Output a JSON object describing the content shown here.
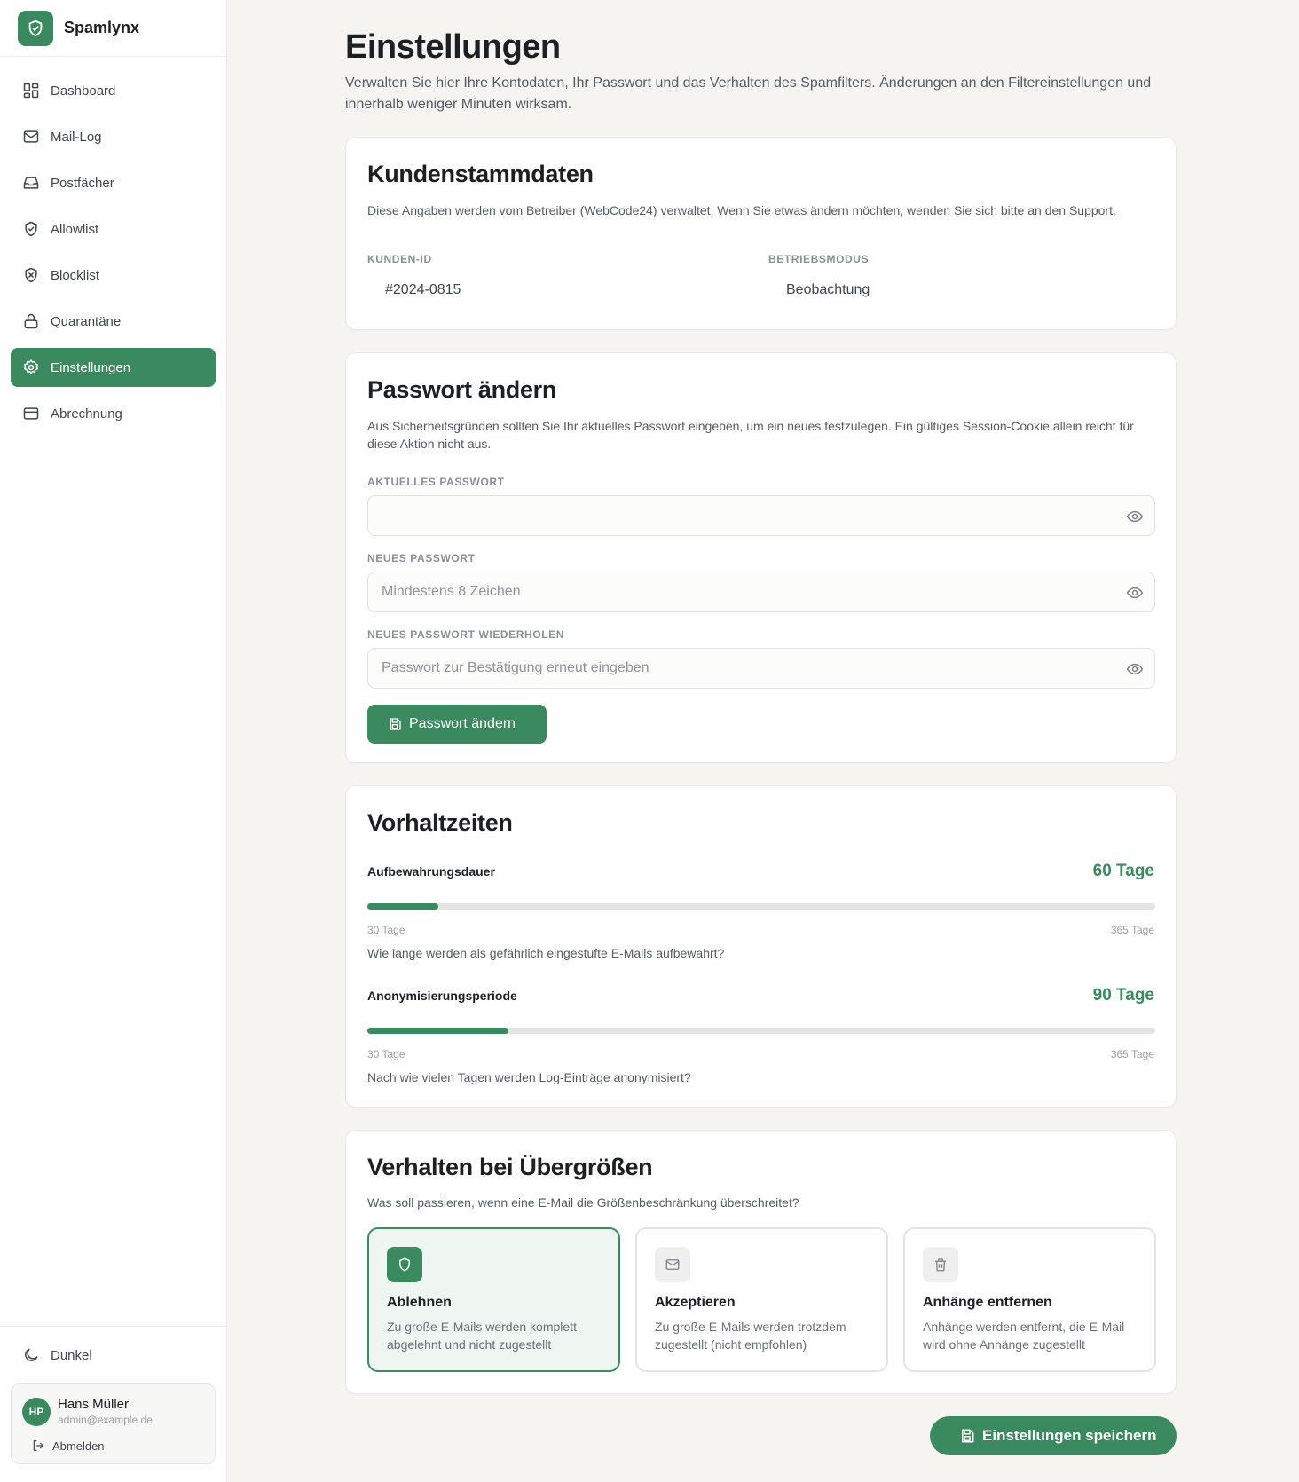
{
  "app": {
    "name": "Spamlynx"
  },
  "sidebar": {
    "items": [
      {
        "label": "Dashboard",
        "icon": "dashboard-icon"
      },
      {
        "label": "Mail-Log",
        "icon": "mail-icon"
      },
      {
        "label": "Postfächer",
        "icon": "inbox-icon"
      },
      {
        "label": "Allowlist",
        "icon": "shield-check-icon"
      },
      {
        "label": "Blocklist",
        "icon": "shield-x-icon"
      },
      {
        "label": "Quarantäne",
        "icon": "lock-icon"
      },
      {
        "label": "Einstellungen",
        "icon": "gear-icon",
        "active": true
      },
      {
        "label": "Abrechnung",
        "icon": "credit-card-icon"
      }
    ],
    "theme_label": "Dunkel",
    "user": {
      "initials": "HP",
      "name": "Hans Müller",
      "email": "admin@example.de",
      "logout_label": "Abmelden"
    }
  },
  "page": {
    "title": "Einstellungen",
    "description": "Verwalten Sie hier Ihre Kontodaten, Ihr Passwort und das Verhalten des Spamfilters. Änderungen an den Filtereinstellungen und innerhalb weniger Minuten wirksam."
  },
  "customer": {
    "title": "Kundenstammdaten",
    "text": "Diese Angaben werden vom Betreiber (WebCode24) verwaltet. Wenn Sie etwas ändern möchten, wenden Sie sich bitte an den Support.",
    "id_label": "Kunden-ID",
    "id_value": "#2024-0815",
    "mode_label": "Betriebsmodus",
    "mode_value": "Beobachtung"
  },
  "password": {
    "title": "Passwort ändern",
    "text": "Aus Sicherheitsgründen sollten Sie Ihr aktuelles Passwort eingeben, um ein neues festzulegen. Ein gültiges Session-Cookie allein reicht für diese Aktion nicht aus.",
    "current_label": "Aktuelles Passwort",
    "current_value": "",
    "current_placeholder": "",
    "new_label": "Neues Passwort",
    "new_value": "",
    "new_placeholder": "Mindestens 8 Zeichen",
    "repeat_label": "Neues Passwort wiederholen",
    "repeat_value": "",
    "repeat_placeholder": "Passwort zur Bestätigung erneut eingeben",
    "submit_label": "Passwort ändern"
  },
  "retention": {
    "title": "Vorhaltzeiten",
    "sliders": [
      {
        "label": "Aufbewahrungsdauer",
        "value": 60,
        "value_text": "60 Tage",
        "min": 30,
        "max": 365,
        "min_text": "30 Tage",
        "max_text": "365 Tage",
        "help": "Wie lange werden als gefährlich eingestufte E-Mails aufbewahrt?"
      },
      {
        "label": "Anonymisierungsperiode",
        "value": 90,
        "value_text": "90 Tage",
        "min": 30,
        "max": 365,
        "min_text": "30 Tage",
        "max_text": "365 Tage",
        "help": "Nach wie vielen Tagen werden Log-Einträge anonymisiert?"
      }
    ]
  },
  "oversize": {
    "title": "Verhalten bei Übergrößen",
    "text": "Was soll passieren, wenn eine E-Mail die Größenbeschränkung überschreitet?",
    "options": [
      {
        "title": "Ablehnen",
        "desc": "Zu große E-Mails werden komplett abgelehnt und nicht zugestellt",
        "icon": "shield-icon",
        "selected": true
      },
      {
        "title": "Akzeptieren",
        "desc": "Zu große E-Mails werden trotzdem zugestellt (nicht empfohlen)",
        "icon": "mail-icon",
        "selected": false
      },
      {
        "title": "Anhänge entfernen",
        "desc": "Anhänge werden entfernt, die E-Mail wird ohne Anhänge zugestellt",
        "icon": "trash-icon",
        "selected": false
      }
    ]
  },
  "save_label": "Einstellungen speichern",
  "colors": {
    "accent": "#3b8a5f",
    "background": "#f5f4f1",
    "surface": "#ffffff"
  }
}
